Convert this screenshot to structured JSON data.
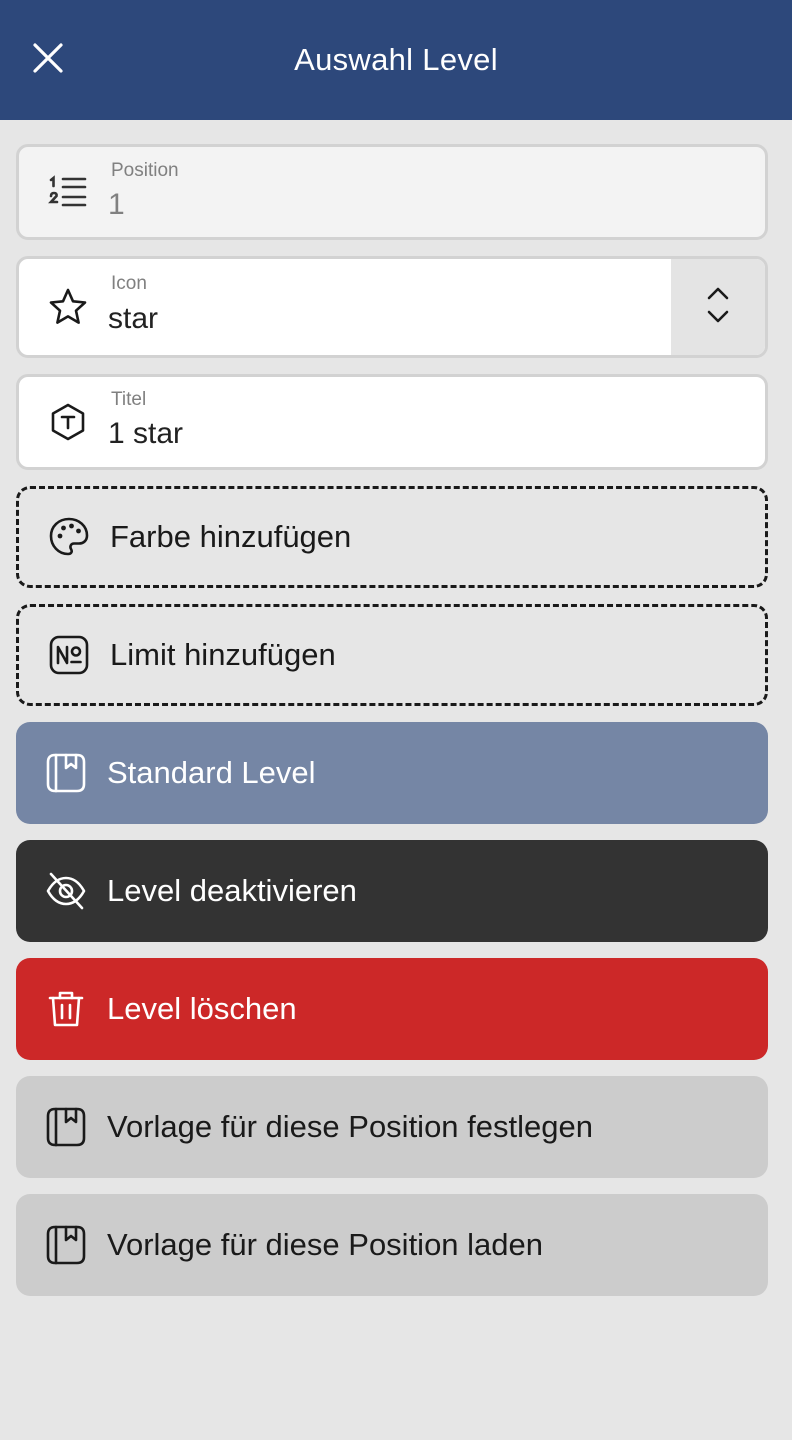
{
  "header": {
    "title": "Auswahl Level",
    "close_icon": "close-icon",
    "background": "#2d487b"
  },
  "fields": {
    "position": {
      "label": "Position",
      "value": "1",
      "icon": "ordered-list-icon"
    },
    "icon": {
      "label": "Icon",
      "value": "star",
      "icon": "star-icon",
      "stepper_icon": "chevron-up-down-icon"
    },
    "title": {
      "label": "Titel",
      "value": "1 star",
      "icon": "title-icon"
    }
  },
  "actions": {
    "add_color": {
      "label": "Farbe hinzufügen",
      "icon": "palette-icon"
    },
    "add_limit": {
      "label": "Limit hinzufügen",
      "icon": "number-sign-icon"
    },
    "standard_level": {
      "label": "Standard Level",
      "icon": "template-icon",
      "color": "#7586a5"
    },
    "deactivate_level": {
      "label": "Level deaktivieren",
      "icon": "eye-off-icon",
      "color": "#333333"
    },
    "delete_level": {
      "label": "Level löschen",
      "icon": "trash-icon",
      "color": "#cc2828"
    },
    "set_template": {
      "label": "Vorlage für diese Position festlegen",
      "icon": "template-icon",
      "color": "#cccccc"
    },
    "load_template": {
      "label": "Vorlage für diese Position laden",
      "icon": "template-icon",
      "color": "#cccccc"
    }
  }
}
